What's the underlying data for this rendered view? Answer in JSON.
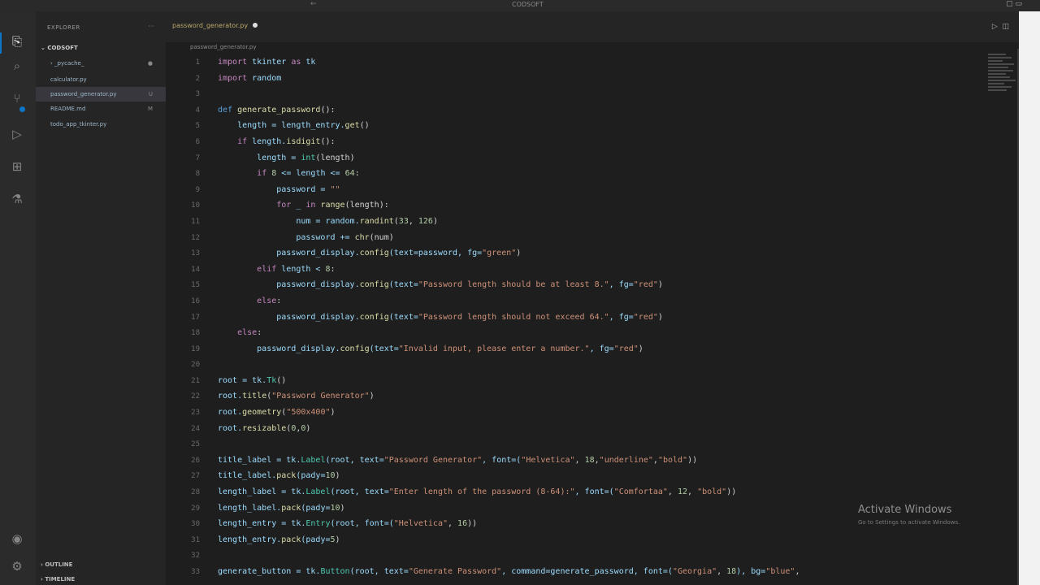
{
  "titlebar": {
    "title": "CODSOFT"
  },
  "sidebar": {
    "header": "EXPLORER",
    "folder": "CODSOFT",
    "items": [
      {
        "label": "_pycache_",
        "mark": "●"
      },
      {
        "label": "calculator.py",
        "mark": ""
      },
      {
        "label": "password_generator.py",
        "mark": "U"
      },
      {
        "label": "README.md",
        "mark": "M"
      },
      {
        "label": "todo_app_tkinter.py",
        "mark": ""
      }
    ],
    "outline": "OUTLINE",
    "timeline": "TIMELINE"
  },
  "tab": {
    "label": "password_generator.py"
  },
  "breadcrumb": "password_generator.py",
  "code": {
    "line_numbers": [
      "1",
      "2",
      "3",
      "4",
      "5",
      "6",
      "7",
      "8",
      "9",
      "10",
      "11",
      "12",
      "13",
      "14",
      "15",
      "16",
      "17",
      "18",
      "19",
      "20",
      "21",
      "22",
      "23",
      "24",
      "25",
      "26",
      "27",
      "28",
      "29",
      "30",
      "31",
      "32",
      "33"
    ],
    "l1": [
      "import",
      " tkinter ",
      "as",
      " tk"
    ],
    "l2": [
      "import",
      " random"
    ],
    "l4": [
      "def ",
      "generate_password",
      "():"
    ],
    "l5": [
      "    length = length_entry.",
      "get",
      "()"
    ],
    "l6": [
      "    ",
      "if",
      " length.",
      "isdigit",
      "():"
    ],
    "l7": [
      "        length = ",
      "int",
      "(length)"
    ],
    "l8": [
      "        ",
      "if",
      " ",
      "8",
      " <= length <= ",
      "64",
      ":"
    ],
    "l9": [
      "            password = ",
      "\"\""
    ],
    "l10": [
      "            ",
      "for",
      " _ ",
      "in",
      " ",
      "range",
      "(length):"
    ],
    "l11": [
      "                num = random.",
      "randint",
      "(",
      "33",
      ", ",
      "126",
      ")"
    ],
    "l12": [
      "                password += ",
      "chr",
      "(num)"
    ],
    "l13": [
      "            password_display.",
      "config",
      "(text=password, fg=",
      "\"green\"",
      ")"
    ],
    "l14": [
      "        ",
      "elif",
      " length < ",
      "8",
      ":"
    ],
    "l15": [
      "            password_display.",
      "config",
      "(text=",
      "\"Password length should be at least 8.\"",
      ", fg=",
      "\"red\"",
      ")"
    ],
    "l16": [
      "        ",
      "else",
      ":"
    ],
    "l17": [
      "            password_display.",
      "config",
      "(text=",
      "\"Password length should not exceed 64.\"",
      ", fg=",
      "\"red\"",
      ")"
    ],
    "l18": [
      "    ",
      "else",
      ":"
    ],
    "l19": [
      "        password_display.",
      "config",
      "(text=",
      "\"Invalid input, please enter a number.\"",
      ", fg=",
      "\"red\"",
      ")"
    ],
    "l21": [
      "root = tk.",
      "Tk",
      "()"
    ],
    "l22": [
      "root.",
      "title",
      "(",
      "\"Password Generator\"",
      ")"
    ],
    "l23": [
      "root.",
      "geometry",
      "(",
      "\"500x400\"",
      ")"
    ],
    "l24": [
      "root.",
      "resizable",
      "(",
      "0",
      ",",
      "0",
      ")"
    ],
    "l26": [
      "title_label = tk.",
      "Label",
      "(root, text=",
      "\"Password Generator\"",
      ", font=(",
      "\"Helvetica\"",
      ", ",
      "18",
      ",",
      "\"underline\"",
      ",",
      "\"bold\"",
      "))"
    ],
    "l27": [
      "title_label.",
      "pack",
      "(pady=",
      "10",
      ")"
    ],
    "l28": [
      "length_label = tk.",
      "Label",
      "(root, text=",
      "\"Enter length of the password (8-64):\"",
      ", font=(",
      "\"Comfortaa\"",
      ", ",
      "12",
      ", ",
      "\"bold\"",
      "))"
    ],
    "l29": [
      "length_label.",
      "pack",
      "(pady=",
      "10",
      ")"
    ],
    "l30": [
      "length_entry = tk.",
      "Entry",
      "(root, font=(",
      "\"Helvetica\"",
      ", ",
      "16",
      "))"
    ],
    "l31": [
      "length_entry.",
      "pack",
      "(pady=",
      "5",
      ")"
    ],
    "l33": [
      "generate_button = tk.",
      "Button",
      "(root, text=",
      "\"Generate Password\"",
      ", command=generate_password, font=(",
      "\"Georgia\"",
      ", ",
      "18",
      "), bg=",
      "\"blue\"",
      ","
    ]
  },
  "watermark": {
    "line1": "Activate Windows",
    "line2": "Go to Settings to activate Windows."
  }
}
